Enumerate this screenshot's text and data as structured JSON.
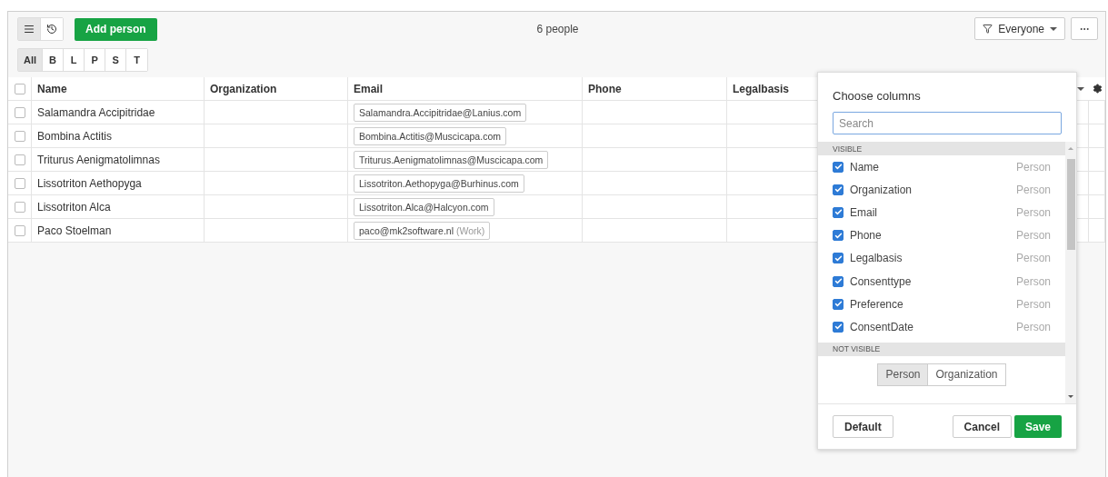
{
  "toolbar": {
    "views": [
      {
        "kind": "list",
        "selected": true
      },
      {
        "kind": "history",
        "selected": false
      }
    ],
    "add_button": "Add person",
    "count": "6 people",
    "filter": "Everyone",
    "letters": [
      {
        "label": "All",
        "selected": true
      },
      {
        "label": "B",
        "selected": false
      },
      {
        "label": "L",
        "selected": false
      },
      {
        "label": "P",
        "selected": false
      },
      {
        "label": "S",
        "selected": false
      },
      {
        "label": "T",
        "selected": false
      }
    ]
  },
  "table": {
    "all_checked": false,
    "columns": [
      "Name",
      "Organization",
      "Email",
      "Phone",
      "Legalbasis"
    ],
    "rows": [
      {
        "checked": false,
        "name": "Salamandra Accipitridae",
        "email": "Salamandra.Accipitridae@Lanius.com"
      },
      {
        "checked": false,
        "name": "Bombina Actitis",
        "email": "Bombina.Actitis@Muscicapa.com"
      },
      {
        "checked": false,
        "name": "Triturus Aenigmatolimnas",
        "email": "Triturus.Aenigmatolimnas@Muscicapa.com"
      },
      {
        "checked": false,
        "name": "Lissotriton Aethopyga",
        "email": "Lissotriton.Aethopyga@Burhinus.com"
      },
      {
        "checked": false,
        "name": "Lissotriton Alca",
        "email": "Lissotriton.Alca@Halcyon.com"
      },
      {
        "checked": false,
        "name": "Paco Stoelman",
        "email": "paco@mk2software.nl",
        "email_tag": "(Work)"
      }
    ]
  },
  "column_chooser": {
    "title": "Choose columns",
    "search_placeholder": "Search",
    "visible_heading": "VISIBLE",
    "visible": [
      {
        "label": "Name",
        "type": "Person",
        "checked": true
      },
      {
        "label": "Organization",
        "type": "Person",
        "checked": true
      },
      {
        "label": "Email",
        "type": "Person",
        "checked": true
      },
      {
        "label": "Phone",
        "type": "Person",
        "checked": true
      },
      {
        "label": "Legalbasis",
        "type": "Person",
        "checked": true
      },
      {
        "label": "Consenttype",
        "type": "Person",
        "checked": true
      },
      {
        "label": "Preference",
        "type": "Person",
        "checked": true
      },
      {
        "label": "ConsentDate",
        "type": "Person",
        "checked": true
      }
    ],
    "not_visible_heading": "NOT VISIBLE",
    "segments": [
      {
        "label": "Person",
        "selected": true
      },
      {
        "label": "Organization",
        "selected": false
      }
    ],
    "buttons": {
      "default": "Default",
      "cancel": "Cancel",
      "save": "Save"
    }
  }
}
